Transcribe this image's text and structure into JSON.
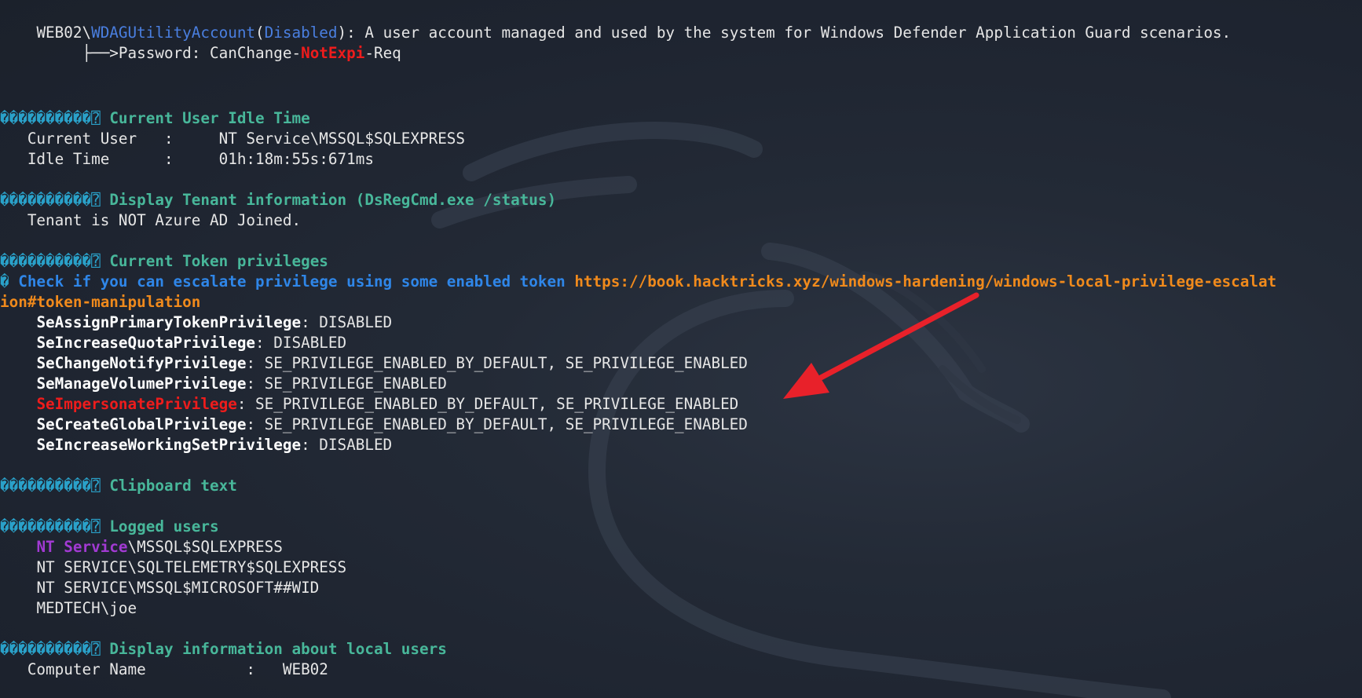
{
  "wdag": {
    "host": "WEB02\\",
    "account": "WDAGUtilityAccount",
    "paren_open": "(",
    "status": "Disabled",
    "paren_close": ")",
    "description": ": A user account managed and used by the system for Windows Defender Application Guard scenarios.",
    "password_prefix": "├──>Password: CanChange-",
    "password_flag": "NotExpi",
    "password_suffix": "-Req"
  },
  "section_marker": "����������⍰",
  "idle": {
    "title": "Current User Idle Time",
    "user_row": "   Current User   :     NT Service\\MSSQL$SQLEXPRESS",
    "idle_row": "   Idle Time      :     01h:18m:55s:671ms"
  },
  "tenant": {
    "title": "Display Tenant information (DsRegCmd.exe /status)",
    "row": "   Tenant is NOT Azure AD Joined."
  },
  "token": {
    "title": "Current Token privileges",
    "check_marker": "�",
    "check_text": " Check if you can escalate privilege using some enabled token ",
    "link_line1": "https://book.hacktricks.xyz/windows-hardening/windows-local-privilege-escalat",
    "link_line2": "ion#token-manipulation",
    "privileges": [
      {
        "name": "SeAssignPrimaryTokenPrivilege",
        "value": ": DISABLED"
      },
      {
        "name": "SeIncreaseQuotaPrivilege",
        "value": ": DISABLED"
      },
      {
        "name": "SeChangeNotifyPrivilege",
        "value": ": SE_PRIVILEGE_ENABLED_BY_DEFAULT, SE_PRIVILEGE_ENABLED"
      },
      {
        "name": "SeManageVolumePrivilege",
        "value": ": SE_PRIVILEGE_ENABLED"
      },
      {
        "name": "SeImpersonatePrivilege",
        "value": ": SE_PRIVILEGE_ENABLED_BY_DEFAULT, SE_PRIVILEGE_ENABLED"
      },
      {
        "name": "SeCreateGlobalPrivilege",
        "value": ": SE_PRIVILEGE_ENABLED_BY_DEFAULT, SE_PRIVILEGE_ENABLED"
      },
      {
        "name": "SeIncreaseWorkingSetPrivilege",
        "value": ": DISABLED"
      }
    ]
  },
  "clipboard": {
    "title": "Clipboard text"
  },
  "logged": {
    "title": "Logged users",
    "first_prefix": "NT Service",
    "first_suffix": "\\MSSQL$SQLEXPRESS",
    "users": [
      "NT SERVICE\\SQLTELEMETRY$SQLEXPRESS",
      "NT SERVICE\\MSSQL$MICROSOFT##WID",
      "MEDTECH\\joe"
    ]
  },
  "local_users": {
    "title": "Display information about local users",
    "row": "   Computer Name           :   WEB02"
  },
  "colors": {
    "background": "#212733",
    "section_title": "#48b79a",
    "marker": "#2aa1c9",
    "highlight": "#ee1c1c",
    "link": "#f08a1c",
    "check": "#2f86e8",
    "service": "#a23ad3",
    "arrow": "#e8212a"
  }
}
